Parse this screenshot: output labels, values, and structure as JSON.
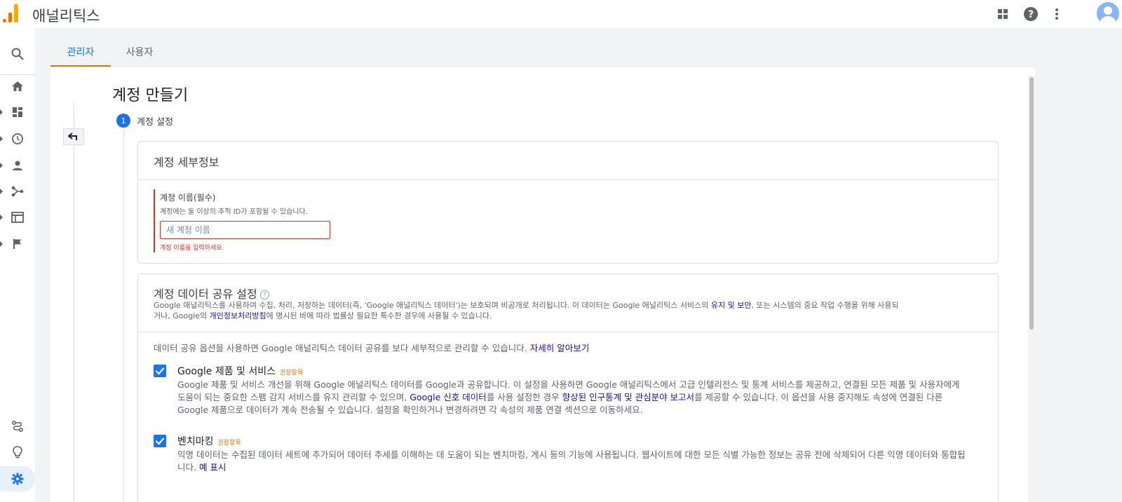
{
  "app": {
    "title": "애널리틱스"
  },
  "tabs": [
    {
      "label": "관리자"
    },
    {
      "label": "사용자"
    }
  ],
  "page": {
    "title": "계정 만들기"
  },
  "step": {
    "number": "1",
    "label": "계정 설정"
  },
  "account_details": {
    "title": "계정 세부정보",
    "field_label": "계정 이름(필수)",
    "field_help": "계정에는 둘 이상의 추적 ID가 포함될 수 있습니다.",
    "field_placeholder": "새 계정 이름",
    "field_value": "",
    "field_error": "계정 이름을 입력하세요."
  },
  "data_sharing": {
    "title": "계정 데이터 공유 설정",
    "desc_part1": "Google 애널리틱스를 사용하여 수집, 처리, 저장하는 데이터(즉, 'Google 애널리틱스 데이터')는 보호되며 비공개로 처리됩니다. 이 데이터는 Google 애널리틱스 서비스의 ",
    "desc_link1": "유지 및 보안",
    "desc_part2": ", 또는 시스템의 중요 작업 수행을 위해 사용되",
    "desc_part3": "거나, Google의 ",
    "desc_link2": "개인정보처리방침",
    "desc_part4": "에 명시된 바에 따라 법률상 필요한 특수한 경우에 사용될 수 있습니다.",
    "intro": "데이터 공유 옵션을 사용하면 Google 애널리틱스 데이터 공유를 보다 세부적으로 관리할 수 있습니다. ",
    "intro_link": "자세히 알아보기",
    "options": [
      {
        "title": "Google 제품 및 서비스",
        "recommended": "권장항목",
        "checked": true,
        "desc_part1": "Google 제품 및 서비스 개선을 위해 Google 애널리틱스 데이터를 Google과 공유합니다. 이 설정을 사용하면 Google 애널리틱스에서 고급 인텔리전스 및 통계 서비스를 제공하고, 연결된 모든 제품 및 사용자에게 도움이 되는 중요한 스팸 감지 서비스를 유지 관리할 수 있으며, ",
        "desc_link1": "Google 신호 데이터",
        "desc_part2": "를 사용 설정한 경우 ",
        "desc_link2": "향상된 인구통계 및 관심분야 보고서",
        "desc_part3": "를 제공할 수 있습니다. 이 옵션을 사용 중지해도 속성에 연결된 다른 Google 제품으로 데이터가 계속 전송될 수 있습니다. 설정을 확인하거나 변경하려면 각 속성의 제품 연결 섹션으로 이동하세요."
      },
      {
        "title": "벤치마킹",
        "recommended": "권장항목",
        "checked": true,
        "desc_part1": "익명 데이터는 수집된 데이터 세트에 추가되어 데이터 추세를 이해하는 데 도움이 되는 벤치마킹, 게시 등의 기능에 사용됩니다. 웹사이트에 대한 모든 식별 가능한 정보는 공유 전에 삭제되어 다른 익명 데이터와 통합됩니다. ",
        "desc_link1": "예 표시"
      }
    ]
  },
  "icons": {
    "top": [
      "apps-icon",
      "help-icon",
      "more-vert-icon"
    ],
    "rail": [
      "search-icon",
      "home-icon",
      "dashboard-icon",
      "clock-icon",
      "person-icon",
      "share-icon",
      "table-icon",
      "flag-icon",
      "route-icon",
      "lightbulb-icon",
      "settings-icon"
    ]
  },
  "colors": {
    "accent": "#1a73e8",
    "tab_underline": "#e37400",
    "error": "#d93025",
    "recommended": "#e37400"
  }
}
